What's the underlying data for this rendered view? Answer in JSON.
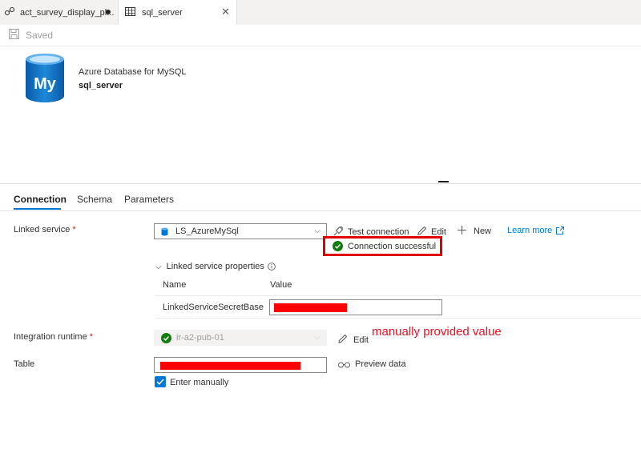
{
  "tabs": [
    {
      "label": "act_survey_display_pl...",
      "icon": "pipeline-icon",
      "unsaved": true
    },
    {
      "label": "sql_server",
      "icon": "table-icon",
      "closable": true
    }
  ],
  "toolbar": {
    "saved_label": "Saved"
  },
  "dataset": {
    "type": "Azure Database for MySQL",
    "name": "sql_server",
    "logo_text": "My"
  },
  "panel_tabs": [
    "Connection",
    "Schema",
    "Parameters"
  ],
  "connection": {
    "linked_service_label": "Linked service",
    "linked_service_value": "LS_AzureMySql",
    "test_connection": "Test connection",
    "edit": "Edit",
    "new": "New",
    "learn_more": "Learn more",
    "status": "Connection successful",
    "props_header": "Linked service properties",
    "col_name": "Name",
    "col_value": "Value",
    "prop_name": "LinkedServiceSecretBase",
    "ir_label": "Integration runtime",
    "ir_value": "ir-a2-pub-01",
    "ir_edit": "Edit",
    "table_label": "Table",
    "preview": "Preview data",
    "enter_manually": "Enter manually",
    "required_mark": "*"
  },
  "annotation": "manually provided value",
  "colors": {
    "accent": "#0078d4",
    "success": "#107c10",
    "redaction": "#ff0000",
    "annotation": "#e81123"
  }
}
